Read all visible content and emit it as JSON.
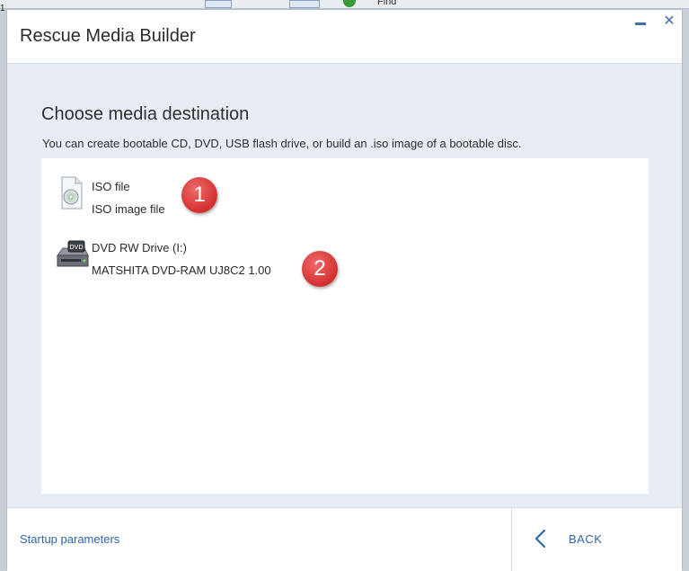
{
  "window": {
    "title": "Rescue Media Builder",
    "minimize_icon": "minimize-icon",
    "close_icon": "close-icon",
    "close_glyph": "✕"
  },
  "background_app": {
    "find_label": "Find",
    "digit": "1"
  },
  "main": {
    "heading": "Choose media destination",
    "description": "You can create bootable CD, DVD, USB flash drive, or build an .iso image of a bootable disc.",
    "destinations": [
      {
        "icon": "iso-file-icon",
        "name": "ISO file",
        "detail": "ISO image file"
      },
      {
        "icon": "dvd-drive-icon",
        "name": "DVD RW Drive (I:)",
        "detail": "MATSHITA DVD-RAM UJ8C2 1.00",
        "icon_text": "DVD"
      }
    ],
    "callouts": [
      "1",
      "2"
    ]
  },
  "footer": {
    "startup_parameters": "Startup parameters",
    "back_label": "BACK",
    "back_icon": "chevron-left-icon"
  },
  "colors": {
    "accent": "#2e65ad",
    "callout": "#d32f2f",
    "dialog_background": "#e8ecf4"
  }
}
